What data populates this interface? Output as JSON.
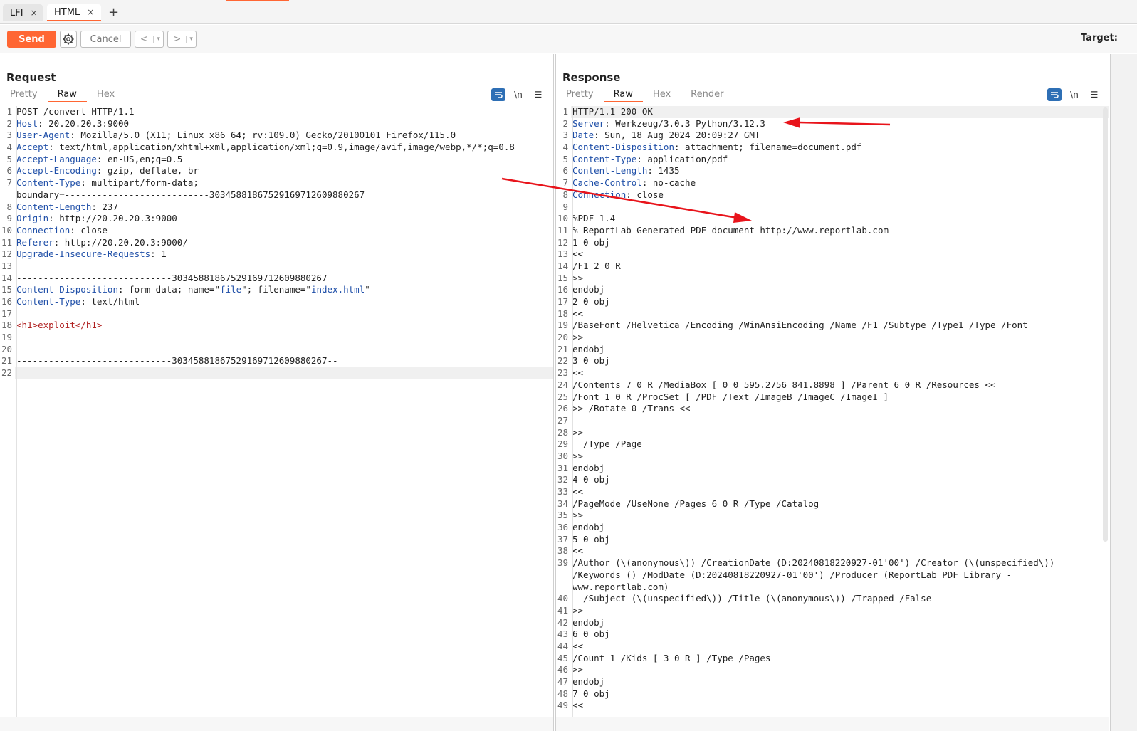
{
  "tabs": [
    {
      "label": "LFI",
      "close": "×"
    },
    {
      "label": "HTML",
      "close": "×"
    }
  ],
  "toolbar": {
    "send": "Send",
    "cancel": "Cancel",
    "back": "<",
    "forward": ">",
    "dropdown": "▾",
    "target_label": "Target:"
  },
  "request": {
    "title": "Request",
    "tabs": [
      "Pretty",
      "Raw",
      "Hex"
    ],
    "active_tab": "Raw",
    "lines": [
      {
        "n": "1",
        "parts": [
          [
            "t",
            "POST /convert HTTP/1.1"
          ]
        ]
      },
      {
        "n": "2",
        "parts": [
          [
            "k",
            "Host"
          ],
          [
            "t",
            ": 20.20.20.3:9000"
          ]
        ]
      },
      {
        "n": "3",
        "parts": [
          [
            "k",
            "User-Agent"
          ],
          [
            "t",
            ": Mozilla/5.0 (X11; Linux x86_64; rv:109.0) Gecko/20100101 Firefox/115.0"
          ]
        ]
      },
      {
        "n": "4",
        "parts": [
          [
            "k",
            "Accept"
          ],
          [
            "t",
            ": text/html,application/xhtml+xml,application/xml;q=0.9,image/avif,image/webp,*/*;q=0.8"
          ]
        ]
      },
      {
        "n": "5",
        "parts": [
          [
            "k",
            "Accept-Language"
          ],
          [
            "t",
            ": en-US,en;q=0.5"
          ]
        ]
      },
      {
        "n": "6",
        "parts": [
          [
            "k",
            "Accept-Encoding"
          ],
          [
            "t",
            ": gzip, deflate, br"
          ]
        ]
      },
      {
        "n": "7",
        "parts": [
          [
            "k",
            "Content-Type"
          ],
          [
            "t",
            ": multipart/form-data;"
          ]
        ]
      },
      {
        "n": "",
        "parts": [
          [
            "t",
            "boundary=---------------------------303458818675291697126098802​67"
          ]
        ]
      },
      {
        "n": "8",
        "parts": [
          [
            "k",
            "Content-Length"
          ],
          [
            "t",
            ": 237"
          ]
        ]
      },
      {
        "n": "9",
        "parts": [
          [
            "k",
            "Origin"
          ],
          [
            "t",
            ": http://20.20.20.3:9000"
          ]
        ]
      },
      {
        "n": "10",
        "parts": [
          [
            "k",
            "Connection"
          ],
          [
            "t",
            ": close"
          ]
        ]
      },
      {
        "n": "11",
        "parts": [
          [
            "k",
            "Referer"
          ],
          [
            "t",
            ": http://20.20.20.3:9000/"
          ]
        ]
      },
      {
        "n": "12",
        "parts": [
          [
            "k",
            "Upgrade-Insecure-Requests"
          ],
          [
            "t",
            ": 1"
          ]
        ]
      },
      {
        "n": "13",
        "parts": [
          [
            "t",
            ""
          ]
        ]
      },
      {
        "n": "14",
        "parts": [
          [
            "t",
            "-----------------------------30345881867529169712609880267"
          ]
        ]
      },
      {
        "n": "15",
        "parts": [
          [
            "k",
            "Content-Disposition"
          ],
          [
            "t",
            ": form-data; name=\""
          ],
          [
            "s",
            "file"
          ],
          [
            "t",
            "\"; filename=\""
          ],
          [
            "s",
            "index.html"
          ],
          [
            "t",
            "\""
          ]
        ]
      },
      {
        "n": "16",
        "parts": [
          [
            "k",
            "Content-Type"
          ],
          [
            "t",
            ": text/html"
          ]
        ]
      },
      {
        "n": "17",
        "parts": [
          [
            "t",
            ""
          ]
        ]
      },
      {
        "n": "18",
        "parts": [
          [
            "g",
            "<h1>exploit</h1>"
          ]
        ]
      },
      {
        "n": "19",
        "parts": [
          [
            "t",
            ""
          ]
        ]
      },
      {
        "n": "20",
        "parts": [
          [
            "t",
            ""
          ]
        ]
      },
      {
        "n": "21",
        "parts": [
          [
            "t",
            "-----------------------------30345881867529169712609880267--"
          ]
        ]
      },
      {
        "n": "22",
        "parts": [
          [
            "t",
            ""
          ]
        ],
        "hl": true
      }
    ]
  },
  "response": {
    "title": "Response",
    "tabs": [
      "Pretty",
      "Raw",
      "Hex",
      "Render"
    ],
    "active_tab": "Raw",
    "lines": [
      {
        "n": "1",
        "parts": [
          [
            "t",
            "HTTP/1.1 200 OK"
          ]
        ],
        "hl": true
      },
      {
        "n": "2",
        "parts": [
          [
            "k",
            "Server"
          ],
          [
            "t",
            ": Werkzeug/3.0.3 Python/3.12.3"
          ]
        ]
      },
      {
        "n": "3",
        "parts": [
          [
            "k",
            "Date"
          ],
          [
            "t",
            ": Sun, 18 Aug 2024 20:09:27 GMT"
          ]
        ]
      },
      {
        "n": "4",
        "parts": [
          [
            "k",
            "Content-Disposition"
          ],
          [
            "t",
            ": attachment; filename=document.pdf"
          ]
        ]
      },
      {
        "n": "5",
        "parts": [
          [
            "k",
            "Content-Type"
          ],
          [
            "t",
            ": application/pdf"
          ]
        ]
      },
      {
        "n": "6",
        "parts": [
          [
            "k",
            "Content-Length"
          ],
          [
            "t",
            ": 1435"
          ]
        ]
      },
      {
        "n": "7",
        "parts": [
          [
            "k",
            "Cache-Control"
          ],
          [
            "t",
            ": no-cache"
          ]
        ]
      },
      {
        "n": "8",
        "parts": [
          [
            "k",
            "Connection"
          ],
          [
            "t",
            ": close"
          ]
        ]
      },
      {
        "n": "9",
        "parts": [
          [
            "t",
            ""
          ]
        ]
      },
      {
        "n": "10",
        "parts": [
          [
            "t",
            "%PDF-1.4"
          ]
        ]
      },
      {
        "n": "11",
        "parts": [
          [
            "t",
            "% ReportLab Generated PDF document http://www.reportlab.com"
          ]
        ]
      },
      {
        "n": "12",
        "parts": [
          [
            "t",
            "1 0 obj"
          ]
        ]
      },
      {
        "n": "13",
        "parts": [
          [
            "t",
            "<<"
          ]
        ]
      },
      {
        "n": "14",
        "parts": [
          [
            "t",
            "/F1 2 0 R"
          ]
        ]
      },
      {
        "n": "15",
        "parts": [
          [
            "t",
            ">>"
          ]
        ]
      },
      {
        "n": "16",
        "parts": [
          [
            "t",
            "endobj"
          ]
        ]
      },
      {
        "n": "17",
        "parts": [
          [
            "t",
            "2 0 obj"
          ]
        ]
      },
      {
        "n": "18",
        "parts": [
          [
            "t",
            "<<"
          ]
        ]
      },
      {
        "n": "19",
        "parts": [
          [
            "t",
            "/BaseFont /Helvetica /Encoding /WinAnsiEncoding /Name /F1 /Subtype /Type1 /Type /Font"
          ]
        ]
      },
      {
        "n": "20",
        "parts": [
          [
            "t",
            ">>"
          ]
        ]
      },
      {
        "n": "21",
        "parts": [
          [
            "t",
            "endobj"
          ]
        ]
      },
      {
        "n": "22",
        "parts": [
          [
            "t",
            "3 0 obj"
          ]
        ]
      },
      {
        "n": "23",
        "parts": [
          [
            "t",
            "<<"
          ]
        ]
      },
      {
        "n": "24",
        "parts": [
          [
            "t",
            "/Contents 7 0 R /MediaBox [ 0 0 595.2756 841.8898 ] /Parent 6 0 R /Resources <<"
          ]
        ]
      },
      {
        "n": "25",
        "parts": [
          [
            "t",
            "/Font 1 0 R /ProcSet [ /PDF /Text /ImageB /ImageC /ImageI ]"
          ]
        ]
      },
      {
        "n": "26",
        "parts": [
          [
            "t",
            ">> /Rotate 0 /Trans <<"
          ]
        ]
      },
      {
        "n": "27",
        "parts": [
          [
            "t",
            ""
          ]
        ]
      },
      {
        "n": "28",
        "parts": [
          [
            "t",
            ">>"
          ]
        ]
      },
      {
        "n": "29",
        "parts": [
          [
            "t",
            "  /Type /Page"
          ]
        ]
      },
      {
        "n": "30",
        "parts": [
          [
            "t",
            ">>"
          ]
        ]
      },
      {
        "n": "31",
        "parts": [
          [
            "t",
            "endobj"
          ]
        ]
      },
      {
        "n": "32",
        "parts": [
          [
            "t",
            "4 0 obj"
          ]
        ]
      },
      {
        "n": "33",
        "parts": [
          [
            "t",
            "<<"
          ]
        ]
      },
      {
        "n": "34",
        "parts": [
          [
            "t",
            "/PageMode /UseNone /Pages 6 0 R /Type /Catalog"
          ]
        ]
      },
      {
        "n": "35",
        "parts": [
          [
            "t",
            ">>"
          ]
        ]
      },
      {
        "n": "36",
        "parts": [
          [
            "t",
            "endobj"
          ]
        ]
      },
      {
        "n": "37",
        "parts": [
          [
            "t",
            "5 0 obj"
          ]
        ]
      },
      {
        "n": "38",
        "parts": [
          [
            "t",
            "<<"
          ]
        ]
      },
      {
        "n": "39",
        "parts": [
          [
            "t",
            "/Author (\\(anonymous\\)) /CreationDate (D:20240818220927-01'00') /Creator (\\(unspecified\\))"
          ]
        ]
      },
      {
        "n": "",
        "parts": [
          [
            "t",
            "/Keywords () /ModDate (D:20240818220927-01'00') /Producer (ReportLab PDF Library -"
          ]
        ]
      },
      {
        "n": "",
        "parts": [
          [
            "t",
            "www.reportlab.com)"
          ]
        ]
      },
      {
        "n": "40",
        "parts": [
          [
            "t",
            "  /Subject (\\(unspecified\\)) /Title (\\(anonymous\\)) /Trapped /False"
          ]
        ]
      },
      {
        "n": "41",
        "parts": [
          [
            "t",
            ">>"
          ]
        ]
      },
      {
        "n": "42",
        "parts": [
          [
            "t",
            "endobj"
          ]
        ]
      },
      {
        "n": "43",
        "parts": [
          [
            "t",
            "6 0 obj"
          ]
        ]
      },
      {
        "n": "44",
        "parts": [
          [
            "t",
            "<<"
          ]
        ]
      },
      {
        "n": "45",
        "parts": [
          [
            "t",
            "/Count 1 /Kids [ 3 0 R ] /Type /Pages"
          ]
        ]
      },
      {
        "n": "46",
        "parts": [
          [
            "t",
            ">>"
          ]
        ]
      },
      {
        "n": "47",
        "parts": [
          [
            "t",
            "endobj"
          ]
        ]
      },
      {
        "n": "48",
        "parts": [
          [
            "t",
            "7 0 obj"
          ]
        ]
      },
      {
        "n": "49",
        "parts": [
          [
            "t",
            "<<"
          ]
        ]
      }
    ]
  },
  "colors": {
    "accent": "#ff6633",
    "header_name": "#1f4fa8",
    "html_tag": "#b02020",
    "annotation_arrow": "#e8141b",
    "toggle_active": "#2e6fb5"
  },
  "icons": {
    "settings": "gear-icon",
    "wrap": "wrap-icon",
    "newline": "\\n",
    "menu": "☰"
  }
}
